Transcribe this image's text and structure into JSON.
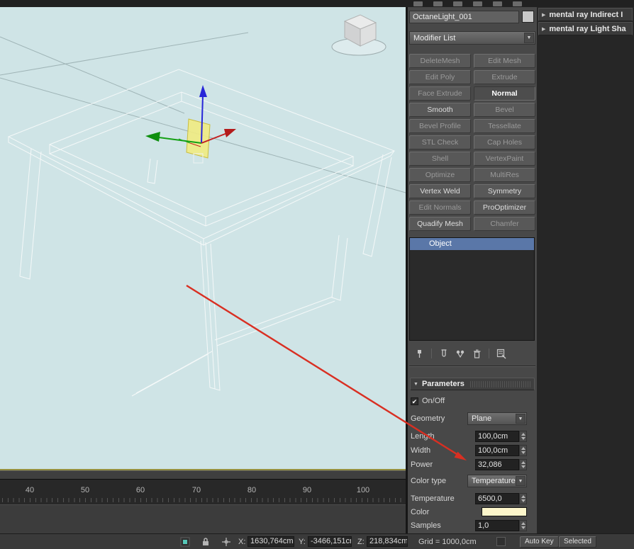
{
  "icons": {
    "dropdown_arrow": "▼",
    "rollout_open": "▼",
    "rollout_closed": "▶",
    "check": "✔"
  },
  "viewport": {
    "background": "#cfe4e6",
    "gizmo_z_label": "Z"
  },
  "annotation": {
    "arrow_color": "#d92f22"
  },
  "command_panel": {
    "object_name": "OctaneLight_001",
    "object_color": "#c9c9c9",
    "modifier_list_label": "Modifier List",
    "modifier_buttons": [
      {
        "label": "DeleteMesh",
        "disabled": true
      },
      {
        "label": "Edit Mesh",
        "disabled": true
      },
      {
        "label": "Edit Poly",
        "disabled": true
      },
      {
        "label": "Extrude",
        "disabled": true
      },
      {
        "label": "Face Extrude",
        "disabled": true
      },
      {
        "label": "Normal",
        "disabled": false,
        "active": true
      },
      {
        "label": "Smooth",
        "disabled": false
      },
      {
        "label": "Bevel",
        "disabled": true
      },
      {
        "label": "Bevel Profile",
        "disabled": true
      },
      {
        "label": "Tessellate",
        "disabled": true
      },
      {
        "label": "STL Check",
        "disabled": true
      },
      {
        "label": "Cap Holes",
        "disabled": true
      },
      {
        "label": "Shell",
        "disabled": true
      },
      {
        "label": "VertexPaint",
        "disabled": true
      },
      {
        "label": "Optimize",
        "disabled": true
      },
      {
        "label": "MultiRes",
        "disabled": true
      },
      {
        "label": "Vertex Weld",
        "disabled": false
      },
      {
        "label": "Symmetry",
        "disabled": false
      },
      {
        "label": "Edit Normals",
        "disabled": true
      },
      {
        "label": "ProOptimizer",
        "disabled": false
      },
      {
        "label": "Quadify Mesh",
        "disabled": false
      },
      {
        "label": "Chamfer",
        "disabled": true
      }
    ],
    "stack": {
      "selected_item": "Object",
      "selection_color": "#5a77a8"
    },
    "parameters": {
      "title": "Parameters",
      "on_off_label": "On/Off",
      "geometry_label": "Geometry",
      "geometry_value": "Plane",
      "length_label": "Length",
      "length_value": "100,0cm",
      "width_label": "Width",
      "width_value": "100,0cm",
      "power_label": "Power",
      "power_value": "32,086",
      "color_type_label": "Color type",
      "color_type_value": "Temperature",
      "temperature_label": "Temperature",
      "temperature_value": "6500,0",
      "color_label": "Color",
      "color_value": "#fdf6cb",
      "samples_label": "Samples",
      "samples_value": "1,0"
    }
  },
  "mental_ray_panel": {
    "rollouts": [
      {
        "label": "mental ray Indirect I"
      },
      {
        "label": "mental ray Light Sha"
      }
    ]
  },
  "timeline": {
    "ticks": [
      "40",
      "50",
      "60",
      "70",
      "80",
      "90",
      "100"
    ]
  },
  "status_bar": {
    "x_label": "X:",
    "x_value": "1630,764cm",
    "y_label": "Y:",
    "y_value": "-3466,151cm",
    "z_label": "Z:",
    "z_value": "218,834cm",
    "grid_label": "Grid = 1000,0cm",
    "auto_key_label": "Auto Key",
    "selected_label": "Selected"
  }
}
